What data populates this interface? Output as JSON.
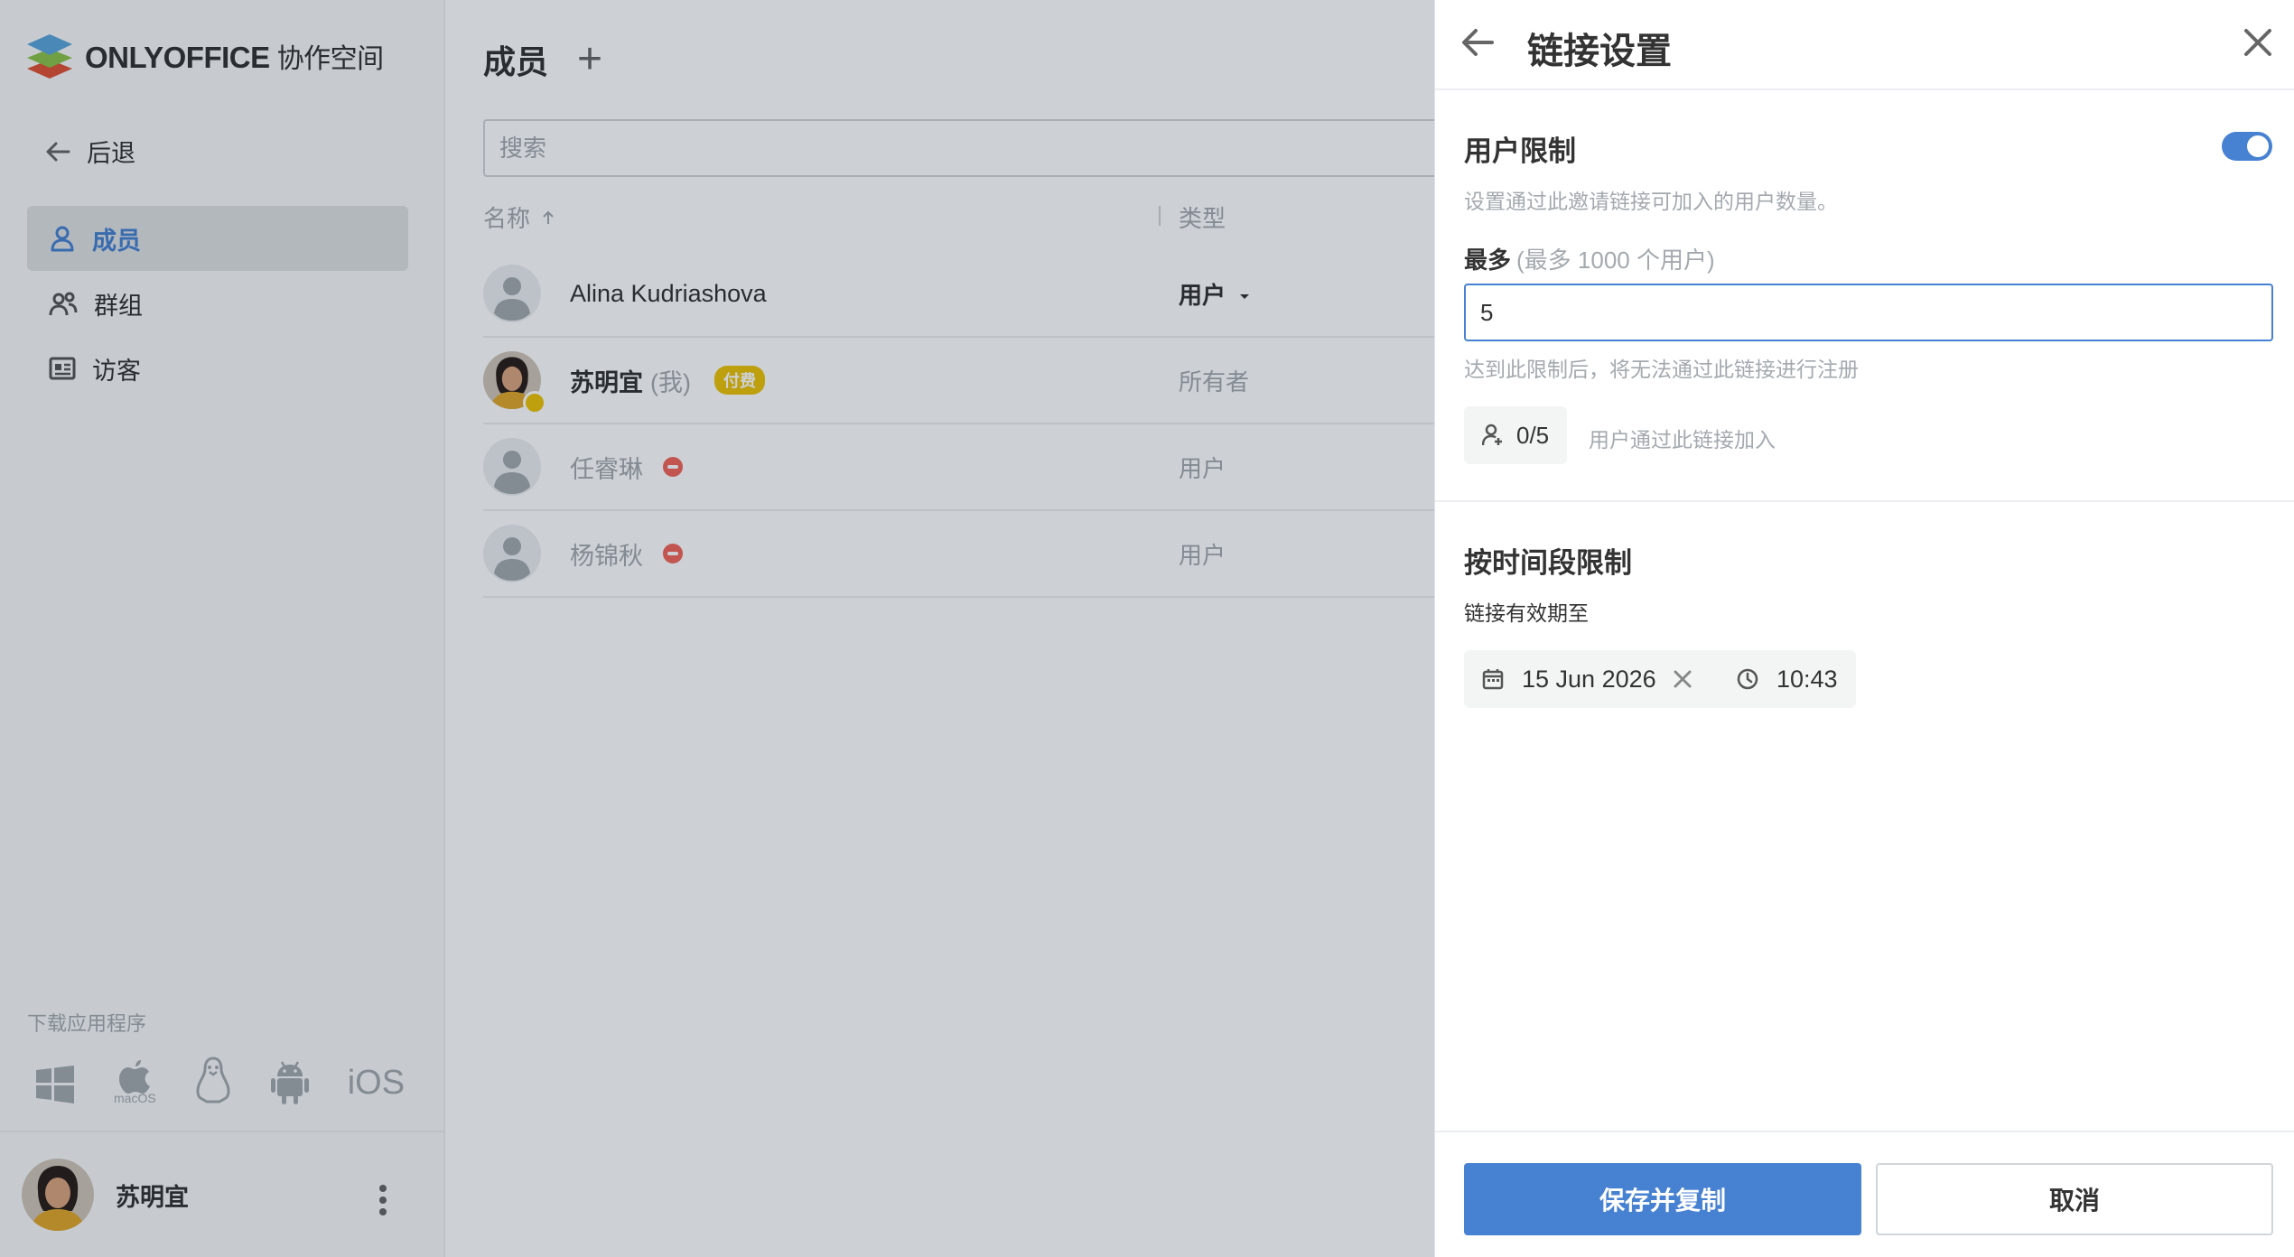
{
  "app": {
    "brand": "ONLYOFFICE",
    "brand_suffix": "协作空间"
  },
  "sidebar": {
    "back_label": "后退",
    "items": [
      {
        "label": "成员",
        "icon": "person-icon",
        "active": true
      },
      {
        "label": "群组",
        "icon": "group-icon",
        "active": false
      },
      {
        "label": "访客",
        "icon": "guest-card-icon",
        "active": false
      }
    ],
    "download_label": "下载应用程序",
    "platforms": [
      "windows-icon",
      "macos-icon",
      "linux-icon",
      "android-icon",
      "ios-icon"
    ],
    "macos_label": "macOS",
    "ios_label": "iOS",
    "profile_name": "苏明宜"
  },
  "main": {
    "title": "成员",
    "search_placeholder": "搜索",
    "columns": {
      "name": "名称",
      "type": "类型"
    },
    "rows": [
      {
        "name": "Alina Kudriashova",
        "type": "用户",
        "type_selectable": true
      },
      {
        "name": "苏明宜",
        "me": "(我)",
        "badge": "付费",
        "type": "所有者"
      },
      {
        "name": "任睿琳",
        "blocked": true,
        "type": "用户"
      },
      {
        "name": "杨锦秋",
        "blocked": true,
        "type": "用户"
      }
    ]
  },
  "panel": {
    "title": "链接设置",
    "user_limit": {
      "title": "用户限制",
      "description": "设置通过此邀请链接可加入的用户数量。",
      "enabled": true,
      "max_label": "最多",
      "max_hint": "(最多 1000 个用户)",
      "max_value": "5",
      "warning": "达到此限制后，将无法通过此链接进行注册",
      "counter": "0/5",
      "counter_note": "用户通过此链接加入"
    },
    "time_limit": {
      "title": "按时间段限制",
      "description": "链接有效期至",
      "date": "15 Jun 2026",
      "time": "10:43"
    },
    "buttons": {
      "save": "保存并复制",
      "cancel": "取消"
    }
  },
  "colors": {
    "accent": "#4781d1",
    "paid_badge": "#edc409",
    "blocked": "#f2665a"
  }
}
